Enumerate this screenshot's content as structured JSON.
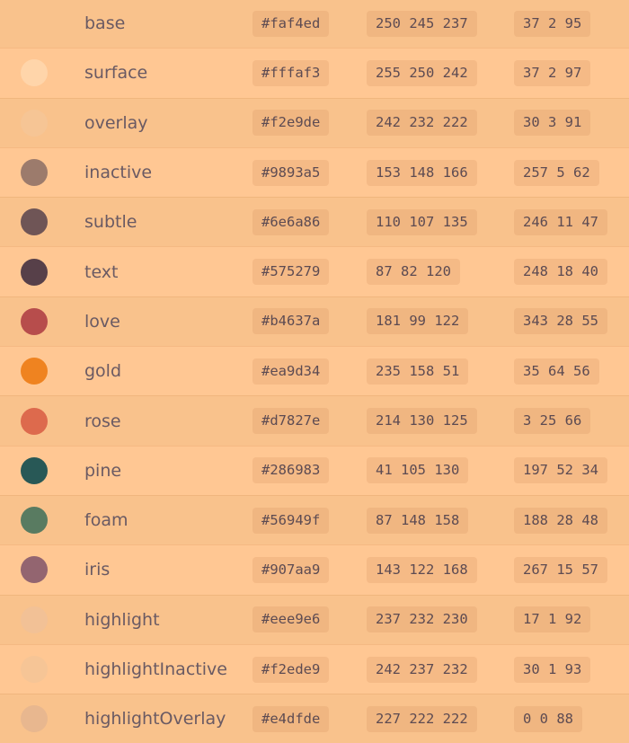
{
  "palette": [
    {
      "name": "base",
      "hex": "#faf4ed",
      "rgb": "250 245 237",
      "hsl": "37 2 95",
      "swatch": null
    },
    {
      "name": "surface",
      "hex": "#fffaf3",
      "rgb": "255 250 242",
      "hsl": "37 2 97",
      "swatch": "#ffd5aa"
    },
    {
      "name": "overlay",
      "hex": "#f2e9de",
      "rgb": "242 232 222",
      "hsl": "30 3 91",
      "swatch": "#f6c595"
    },
    {
      "name": "inactive",
      "hex": "#9893a5",
      "rgb": "153 148 166",
      "hsl": "257 5 62",
      "swatch": "#9c7b6c"
    },
    {
      "name": "subtle",
      "hex": "#6e6a86",
      "rgb": "110 107 135",
      "hsl": "246 11 47",
      "swatch": "#6f5556"
    },
    {
      "name": "text",
      "hex": "#575279",
      "rgb": "87 82 120",
      "hsl": "248 18 40",
      "swatch": "#574049"
    },
    {
      "name": "love",
      "hex": "#b4637a",
      "rgb": "181 99 122",
      "hsl": "343 28 55",
      "swatch": "#b74d4c"
    },
    {
      "name": "gold",
      "hex": "#ea9d34",
      "rgb": "235 158 51",
      "hsl": "35 64 56",
      "swatch": "#ef8320"
    },
    {
      "name": "rose",
      "hex": "#d7827e",
      "rgb": "214 130 125",
      "hsl": "3 25 66",
      "swatch": "#dd6a4d"
    },
    {
      "name": "pine",
      "hex": "#286983",
      "rgb": "41 105 130",
      "hsl": "197 52 34",
      "swatch": "#285856"
    },
    {
      "name": "foam",
      "hex": "#56949f",
      "rgb": "87 148 158",
      "hsl": "188 28 48",
      "swatch": "#597b61"
    },
    {
      "name": "iris",
      "hex": "#907aa9",
      "rgb": "143 122 168",
      "hsl": "267 15 57",
      "swatch": "#936570"
    },
    {
      "name": "highlight",
      "hex": "#eee9e6",
      "rgb": "237 232 230",
      "hsl": "17 1 92",
      "swatch": "#f2c196"
    },
    {
      "name": "highlightInactive",
      "hex": "#f2ede9",
      "rgb": "242 237 232",
      "hsl": "30 1 93",
      "swatch": "#f6c596"
    },
    {
      "name": "highlightOverlay",
      "hex": "#e4dfde",
      "rgb": "227 222 222",
      "hsl": "0 0 88",
      "swatch": "#e8b78f"
    }
  ]
}
